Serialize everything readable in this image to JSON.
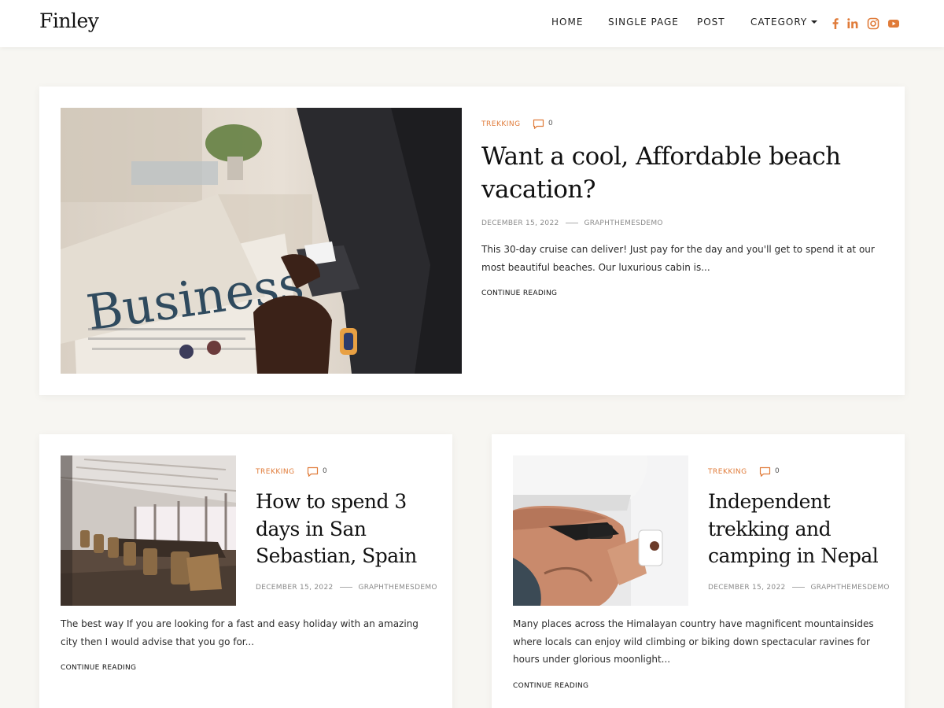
{
  "site": {
    "logo": "Finley"
  },
  "nav": {
    "items": [
      "HOME",
      "SINGLE PAGE",
      "POST",
      "CATEGORY"
    ]
  },
  "social": [
    "facebook-icon",
    "linkedin-icon",
    "instagram-icon",
    "youtube-icon"
  ],
  "colors": {
    "accent": "#e07b39",
    "background": "#f7f6f2",
    "card": "#ffffff"
  },
  "posts": [
    {
      "category": "TREKKING",
      "comments": "0",
      "title": "Want a cool, Affordable beach vacation?",
      "date": "DECEMBER 15, 2022",
      "author": "GRAPHTHEMESDEMO",
      "excerpt": "This 30-day cruise can deliver! Just pay for the day and you'll get to spend it at our most beautiful beaches. Our luxurious cabin is...",
      "more": "CONTINUE READING",
      "image": "newspaper-business-photo"
    },
    {
      "category": "TREKKING",
      "comments": "0",
      "title": "How to spend 3 days in San Sebastian, Spain",
      "date": "DECEMBER 15, 2022",
      "author": "GRAPHTHEMESDEMO",
      "excerpt": "The best way If you are looking for a fast and easy holiday with an amazing city then I would advise that you go for...",
      "more": "CONTINUE READING",
      "image": "conference-room-photo"
    },
    {
      "category": "TREKKING",
      "comments": "0",
      "title": "Independent trekking and camping in Nepal",
      "date": "DECEMBER 15, 2022",
      "author": "GRAPHTHEMESDEMO",
      "excerpt": "Many places across the Himalayan country have magnificent mountainsides where locals can enjoy wild climbing or biking down spectacular ravines for hours under glorious moonlight...",
      "more": "CONTINUE READING",
      "image": "electrician-hardhat-photo"
    }
  ]
}
